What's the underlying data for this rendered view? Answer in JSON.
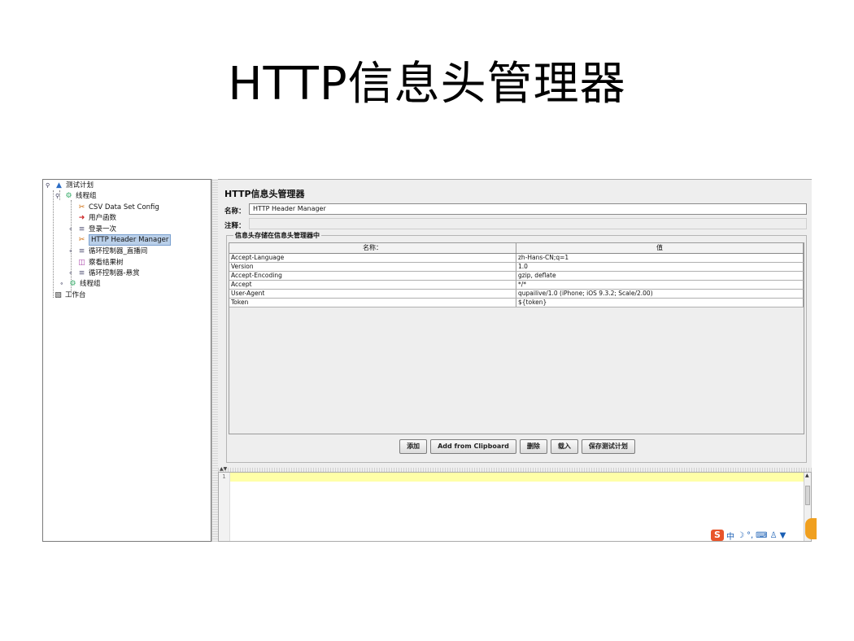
{
  "slide": {
    "title": "HTTP信息头管理器"
  },
  "tree": {
    "items": [
      {
        "label": "测试计划",
        "icon": "test-plan-icon"
      },
      {
        "label": "线程组",
        "icon": "thread-group-icon"
      },
      {
        "label": "CSV Data Set Config",
        "icon": "config-scissors-icon"
      },
      {
        "label": "用户函数",
        "icon": "user-function-icon"
      },
      {
        "label": "登录一次",
        "icon": "controller-icon"
      },
      {
        "label": "HTTP Header Manager",
        "icon": "config-scissors-icon"
      },
      {
        "label": "循环控制器_直播间",
        "icon": "controller-icon"
      },
      {
        "label": "察看结果树",
        "icon": "listener-icon"
      },
      {
        "label": "循环控制器-悬赏",
        "icon": "controller-icon"
      },
      {
        "label": "线程组",
        "icon": "thread-group-icon"
      },
      {
        "label": "工作台",
        "icon": "workbench-icon"
      }
    ]
  },
  "editor": {
    "title": "HTTP信息头管理器",
    "name_label": "名称：",
    "name_value": "HTTP Header Manager",
    "comment_label": "注释：",
    "group_title": "信息头存储在信息头管理器中",
    "table": {
      "headers": [
        "名称：",
        "值"
      ],
      "rows": [
        [
          "Accept-Language",
          "zh-Hans-CN;q=1"
        ],
        [
          "Version",
          "1.0"
        ],
        [
          "Accept-Encoding",
          "gzip, deflate"
        ],
        [
          "Accept",
          "*/*"
        ],
        [
          "User-Agent",
          "qupailive/1.0 (iPhone; iOS 9.3.2; Scale/2.00)"
        ],
        [
          "Token",
          "${token}"
        ]
      ]
    },
    "buttons": {
      "add": "添加",
      "clipboard": "Add from Clipboard",
      "delete": "删除",
      "load": "载入",
      "save": "保存测试计划"
    }
  },
  "log": {
    "line_number": "1"
  },
  "ime": {
    "logo": "S",
    "mode": "中",
    "icons": [
      "moon-icon",
      "punctuation-icon",
      "keyboard-icon",
      "user-icon",
      "shirt-icon"
    ]
  }
}
